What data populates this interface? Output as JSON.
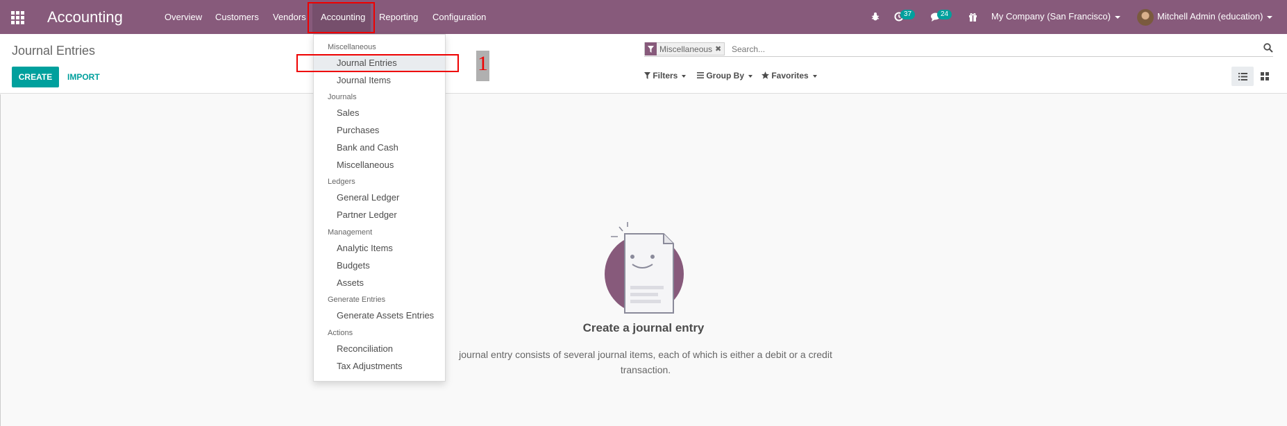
{
  "navbar": {
    "app_title": "Accounting",
    "menu": [
      "Overview",
      "Customers",
      "Vendors",
      "Accounting",
      "Reporting",
      "Configuration"
    ],
    "activities_count": "37",
    "messages_count": "24",
    "company": "My Company (San Francisco)",
    "user": "Mitchell Admin (education)",
    "icons": [
      "apps-grid-icon",
      "bug-icon",
      "clock-icon",
      "chat-icon",
      "gift-icon"
    ]
  },
  "control_panel": {
    "breadcrumb": "Journal Entries",
    "create_label": "CREATE",
    "import_label": "IMPORT",
    "facet_label": "Miscellaneous",
    "search_placeholder": "Search...",
    "filters_label": "Filters",
    "groupby_label": "Group By",
    "favorites_label": "Favorites"
  },
  "dropdown": {
    "sections": [
      {
        "header": "Miscellaneous",
        "items": [
          "Journal Entries",
          "Journal Items"
        ]
      },
      {
        "header": "Journals",
        "items": [
          "Sales",
          "Purchases",
          "Bank and Cash",
          "Miscellaneous"
        ]
      },
      {
        "header": "Ledgers",
        "items": [
          "General Ledger",
          "Partner Ledger"
        ]
      },
      {
        "header": "Management",
        "items": [
          "Analytic Items",
          "Budgets",
          "Assets"
        ]
      },
      {
        "header": "Generate Entries",
        "items": [
          "Generate Assets Entries"
        ]
      },
      {
        "header": "Actions",
        "items": [
          "Reconciliation",
          "Tax Adjustments"
        ]
      }
    ],
    "active_item": "Journal Entries"
  },
  "help": {
    "title": "Create a journal entry",
    "text": "journal entry consists of several journal items, each of which is either a debit or a credit transaction."
  },
  "annotation": {
    "step": "1"
  },
  "colors": {
    "primary": "#875a7b",
    "accent": "#00a09d",
    "annotation": "#e00000"
  }
}
